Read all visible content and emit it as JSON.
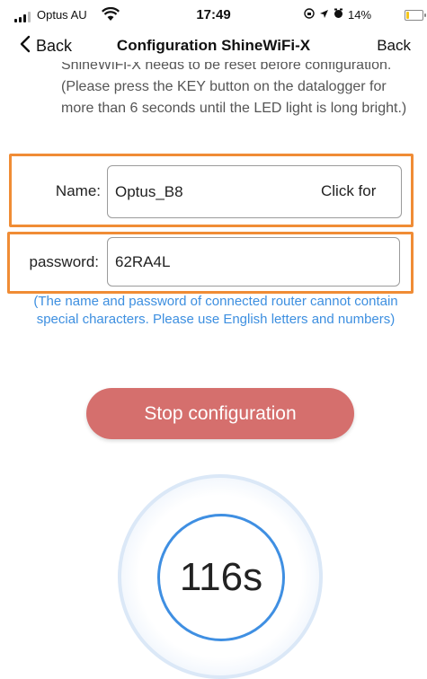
{
  "status_bar": {
    "carrier": "Optus AU",
    "time": "17:49",
    "battery_percent": "14%",
    "battery_level": 0.14,
    "icons": [
      "signal-icon",
      "wifi-icon",
      "screen-lock-icon",
      "location-icon",
      "alarm-icon",
      "battery-icon"
    ]
  },
  "nav": {
    "back_left": "Back",
    "title": "Configuration ShineWiFi-X",
    "back_right": "Back"
  },
  "instructions": "ShineWiFi-X needs to be reset before configuration. (Please press the KEY button on the datalogger for more than 6 seconds until the LED light is long bright.)",
  "form": {
    "name_label": "Name:",
    "name_value": "Optus_B8",
    "name_hint": "Click for",
    "password_label": "password:",
    "password_value": "62RA4L"
  },
  "note": "(The name and password of connected router cannot contain special characters. Please use English letters and numbers)",
  "stop_button": "Stop configuration",
  "countdown": "116s",
  "colors": {
    "highlight": "#f08c35",
    "accent_blue": "#3d8fe0",
    "button": "#d56f6d"
  }
}
